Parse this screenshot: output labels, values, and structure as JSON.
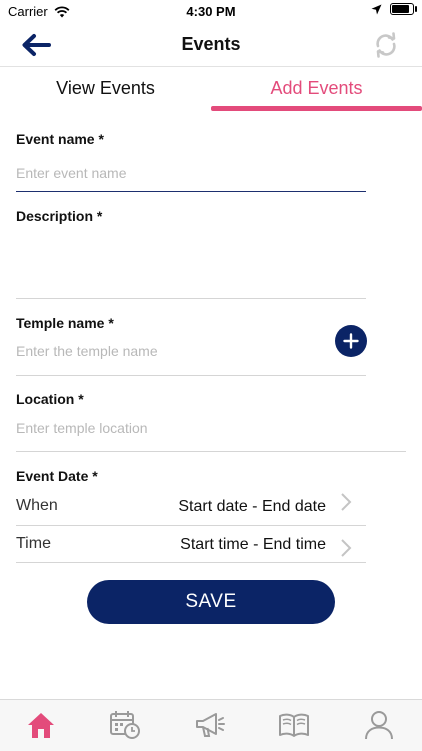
{
  "status_bar": {
    "carrier": "Carrier",
    "time": "4:30 PM"
  },
  "nav": {
    "title": "Events"
  },
  "tabs": [
    {
      "label": "View Events",
      "active": false
    },
    {
      "label": "Add Events",
      "active": true
    }
  ],
  "form": {
    "event_name": {
      "label": "Event name *",
      "value": "",
      "placeholder": "Enter event name"
    },
    "description": {
      "label": "Description *",
      "value": ""
    },
    "temple_name": {
      "label": "Temple name *",
      "value": "",
      "placeholder": "Enter the temple name"
    },
    "location": {
      "label": "Location *",
      "value": "",
      "placeholder": "Enter temple location"
    },
    "event_date": {
      "label": "Event Date *",
      "when": {
        "label": "When",
        "value": "Start date - End date"
      },
      "time": {
        "label": "Time",
        "value": "Start time - End time"
      }
    },
    "save_label": "SAVE"
  },
  "bottom_tabs": [
    {
      "icon": "home-icon",
      "active": true
    },
    {
      "icon": "calendar-clock-icon",
      "active": false
    },
    {
      "icon": "megaphone-icon",
      "active": false
    },
    {
      "icon": "book-icon",
      "active": false
    },
    {
      "icon": "profile-icon",
      "active": false
    }
  ],
  "colors": {
    "accent_pink": "#e34b7b",
    "primary_navy": "#0b2466",
    "inactive_icon": "#9a9a9a"
  }
}
